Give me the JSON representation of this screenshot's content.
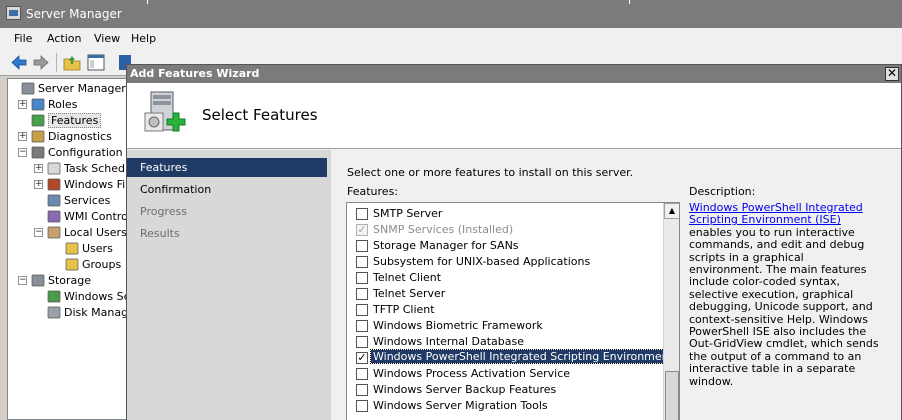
{
  "server_manager": {
    "title": "Server Manager",
    "menu": [
      "File",
      "Action",
      "View",
      "Help"
    ],
    "tree": [
      {
        "label": "Server Manager (D:",
        "icon": "server-icon",
        "level": 0
      },
      {
        "label": "Roles",
        "icon": "roles-icon",
        "level": 1,
        "expander": "+"
      },
      {
        "label": "Features",
        "icon": "features-icon",
        "level": 1,
        "selected": true
      },
      {
        "label": "Diagnostics",
        "icon": "diagnostics-icon",
        "level": 1,
        "expander": "+"
      },
      {
        "label": "Configuration",
        "icon": "configuration-icon",
        "level": 1,
        "expander": "−"
      },
      {
        "label": "Task Sched",
        "icon": "clock-icon",
        "level": 2,
        "expander": "+"
      },
      {
        "label": "Windows Fi",
        "icon": "firewall-icon",
        "level": 2,
        "expander": "+"
      },
      {
        "label": "Services",
        "icon": "gear-icon",
        "level": 2
      },
      {
        "label": "WMI Contro",
        "icon": "wmi-icon",
        "level": 2
      },
      {
        "label": "Local Users",
        "icon": "users-icon",
        "level": 2,
        "expander": "−"
      },
      {
        "label": "Users",
        "icon": "folder-icon",
        "level": 3
      },
      {
        "label": "Groups",
        "icon": "folder-icon",
        "level": 3
      },
      {
        "label": "Storage",
        "icon": "storage-icon",
        "level": 1,
        "expander": "−"
      },
      {
        "label": "Windows Se",
        "icon": "backup-icon",
        "level": 2
      },
      {
        "label": "Disk Manag",
        "icon": "disk-icon",
        "level": 2
      }
    ]
  },
  "wizard": {
    "title": "Add Features Wizard",
    "header_title": "Select Features",
    "steps": [
      {
        "label": "Features",
        "state": "active"
      },
      {
        "label": "Confirmation",
        "state": "normal"
      },
      {
        "label": "Progress",
        "state": "dim"
      },
      {
        "label": "Results",
        "state": "dim"
      }
    ],
    "instruction": "Select one or more features to install on this server.",
    "features_label": "Features:",
    "features": [
      {
        "label": "SMTP Server",
        "checked": false,
        "disabled": false
      },
      {
        "label": "SNMP Services  (Installed)",
        "checked": true,
        "disabled": true
      },
      {
        "label": "Storage Manager for SANs",
        "checked": false,
        "disabled": false
      },
      {
        "label": "Subsystem for UNIX-based Applications",
        "checked": false,
        "disabled": false
      },
      {
        "label": "Telnet Client",
        "checked": false,
        "disabled": false
      },
      {
        "label": "Telnet Server",
        "checked": false,
        "disabled": false
      },
      {
        "label": "TFTP Client",
        "checked": false,
        "disabled": false
      },
      {
        "label": "Windows Biometric Framework",
        "checked": false,
        "disabled": false
      },
      {
        "label": "Windows Internal Database",
        "checked": false,
        "disabled": false
      },
      {
        "label": "Windows PowerShell Integrated Scripting Environment (ISE)",
        "checked": true,
        "disabled": false,
        "selected": true
      },
      {
        "label": "Windows Process Activation Service",
        "checked": false,
        "disabled": false
      },
      {
        "label": "Windows Server Backup Features",
        "checked": false,
        "disabled": false
      },
      {
        "label": "Windows Server Migration Tools",
        "checked": false,
        "disabled": false
      }
    ],
    "description_title": "Description:",
    "description_link": "Windows PowerShell Integrated Scripting Environment (ISE)",
    "description_text": " enables you to run interactive commands, and edit and debug scripts in a graphical environment. The main features include color-coded syntax, selective execution, graphical debugging, Unicode support, and context-sensitive Help. Windows PowerShell ISE also includes the Out-GridView cmdlet, which sends the output of a command to an interactive table in a separate window."
  },
  "colors": {
    "active_step": "#1f3a64",
    "titlebar": "#7b7b7b",
    "link": "#0000ee"
  }
}
